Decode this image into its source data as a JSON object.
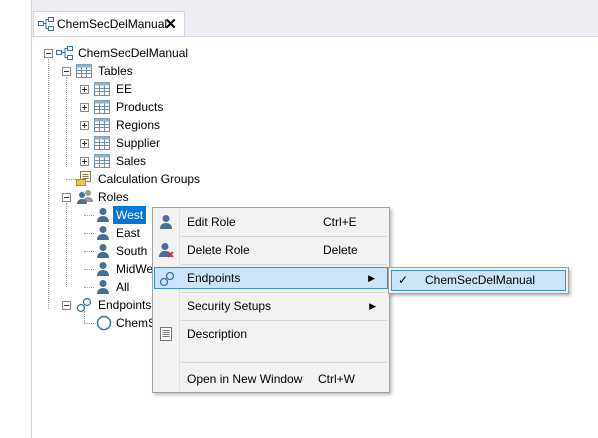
{
  "tab": {
    "title": "ChemSecDelManual",
    "close": "✕",
    "icon": "model-icon"
  },
  "tree": {
    "root": "ChemSecDelManual",
    "tables": {
      "label": "Tables",
      "items": [
        "EE",
        "Products",
        "Regions",
        "Supplier",
        "Sales"
      ]
    },
    "calc_groups": "Calculation Groups",
    "roles": {
      "label": "Roles",
      "items": [
        "West",
        "East",
        "South",
        "MidWe",
        "All"
      ]
    },
    "endpoints": {
      "label": "Endpoints",
      "items": [
        "ChemS"
      ]
    }
  },
  "context_menu": {
    "edit_role": {
      "label": "Edit Role",
      "shortcut": "Ctrl+E"
    },
    "delete_role": {
      "label": "Delete Role",
      "shortcut": "Delete"
    },
    "endpoints": {
      "label": "Endpoints",
      "arrow": "▶"
    },
    "security_setups": {
      "label": "Security Setups",
      "arrow": "▶"
    },
    "description": {
      "label": "Description"
    },
    "open_new_window": {
      "label": "Open in New Window",
      "shortcut": "Ctrl+W"
    }
  },
  "submenu": {
    "check": "✓",
    "item": "ChemSecDelManual"
  },
  "colors": {
    "selection": "#0078d7",
    "highlight": "#cce4f7",
    "highlight_border": "#3c8fd6"
  }
}
